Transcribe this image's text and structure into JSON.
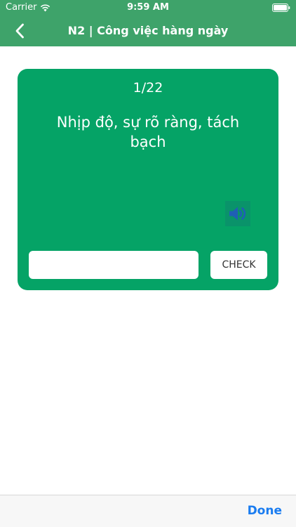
{
  "status_bar": {
    "carrier": "Carrier",
    "time": "9:59 AM",
    "wifi_icon": "wifi-icon",
    "battery_icon": "battery-icon"
  },
  "nav": {
    "back_icon": "chevron-left-icon",
    "title": "N2 | Công việc hàng ngày"
  },
  "card": {
    "progress": "1/22",
    "question": "Nhịp độ, sự rõ ràng, tách bạch",
    "speaker_icon": "speaker-icon",
    "answer": {
      "value": "",
      "placeholder": ""
    },
    "check_label": "CHECK"
  },
  "toolbar": {
    "done_label": "Done"
  },
  "colors": {
    "header": "#3ea36a",
    "card": "#05a366",
    "speaker": "#1f5fb5",
    "done": "#1a7cf0"
  }
}
